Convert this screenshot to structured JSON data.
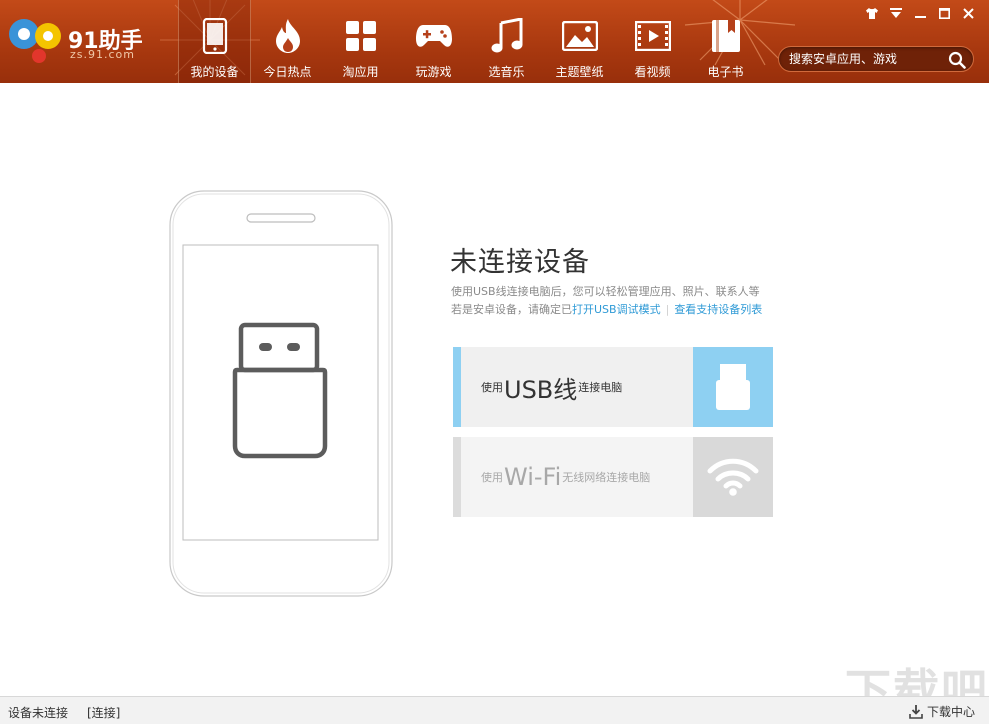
{
  "app": {
    "logo_text": "91助手",
    "logo_sub": "zs.91.com"
  },
  "nav": [
    {
      "label": "我的设备",
      "icon": "phone-icon",
      "active": true
    },
    {
      "label": "今日热点",
      "icon": "flame-icon",
      "active": false
    },
    {
      "label": "淘应用",
      "icon": "apps-grid-icon",
      "active": false
    },
    {
      "label": "玩游戏",
      "icon": "gamepad-icon",
      "active": false
    },
    {
      "label": "选音乐",
      "icon": "music-note-icon",
      "active": false
    },
    {
      "label": "主题壁纸",
      "icon": "picture-icon",
      "active": false
    },
    {
      "label": "看视频",
      "icon": "film-icon",
      "active": false
    },
    {
      "label": "电子书",
      "icon": "book-icon",
      "active": false
    }
  ],
  "search": {
    "placeholder": "搜索安卓应用、游戏"
  },
  "main": {
    "headline": "未连接设备",
    "desc_line1": "使用USB线连接电脑后，您可以轻松管理应用、照片、联系人等",
    "desc_line2_prefix": "若是安卓设备，请确定已",
    "link_usb_debug": "打开USB调试模式",
    "link_supported": "查看支持设备列表",
    "usb_card": {
      "pre": "使用",
      "big": "USB线",
      "post": "连接电脑"
    },
    "wifi_card": {
      "pre": "使用",
      "big": "Wi-Fi",
      "post": "无线网络连接电脑"
    }
  },
  "status": {
    "text": "设备未连接",
    "connect": "[连接]",
    "download_center": "下载中心"
  },
  "watermark": "下载吧",
  "colors": {
    "topbar": "#a8380f",
    "usb_accent": "#8ed0f2",
    "link": "#2f9ad6"
  }
}
